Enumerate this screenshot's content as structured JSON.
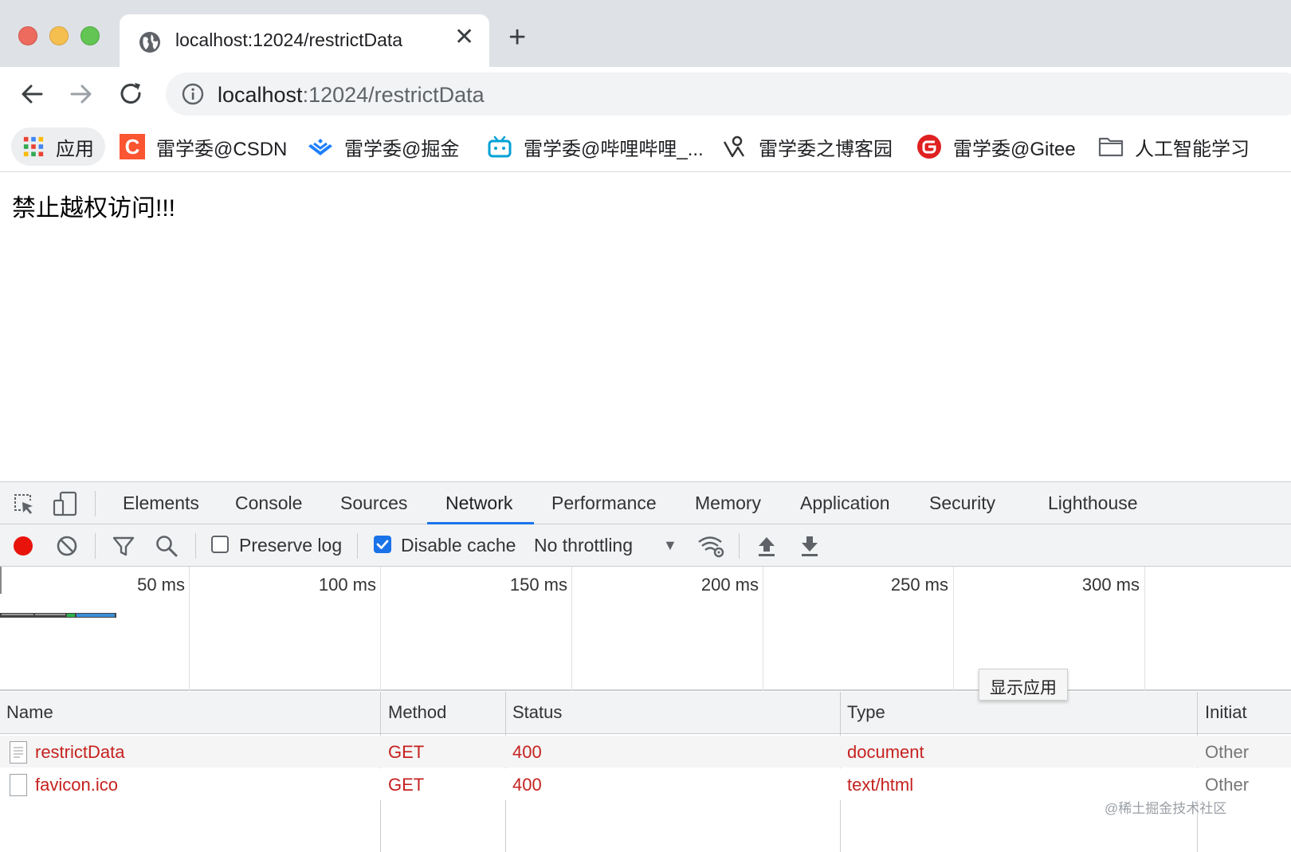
{
  "browser": {
    "tab": {
      "title": "localhost:12024/restrictData"
    },
    "address": {
      "host": "localhost",
      "path": ":12024/restrictData"
    },
    "bookmarks": {
      "apps_label": "应用",
      "items": [
        {
          "label": "雷学委@CSDN"
        },
        {
          "label": "雷学委@掘金"
        },
        {
          "label": "雷学委@哔哩哔哩_..."
        },
        {
          "label": "雷学委之博客园"
        },
        {
          "label": "雷学委@Gitee"
        },
        {
          "label": "人工智能学习"
        }
      ]
    }
  },
  "page": {
    "message": "禁止越权访问!!!"
  },
  "devtools": {
    "tabs": [
      "Elements",
      "Console",
      "Sources",
      "Network",
      "Performance",
      "Memory",
      "Application",
      "Security",
      "Lighthouse"
    ],
    "active_tab": "Network",
    "toolbar": {
      "preserve_log_label": "Preserve log",
      "preserve_log_checked": false,
      "disable_cache_label": "Disable cache",
      "disable_cache_checked": true,
      "throttling": "No throttling"
    },
    "timeline": {
      "ticks": [
        "50 ms",
        "100 ms",
        "150 ms",
        "200 ms",
        "250 ms",
        "300 ms"
      ]
    },
    "tooltip": "显示应用",
    "table": {
      "columns": [
        "Name",
        "Method",
        "Status",
        "Type",
        "Initiat"
      ],
      "rows": [
        {
          "name": "restrictData",
          "method": "GET",
          "status": "400",
          "type": "document",
          "initiator": "Other"
        },
        {
          "name": "favicon.ico",
          "method": "GET",
          "status": "400",
          "type": "text/html",
          "initiator": "Other"
        }
      ]
    }
  },
  "watermark": "@稀土掘金技术社区",
  "colors": {
    "accent": "#1a73e8",
    "error_text": "#c5221f",
    "record": "#e8140c"
  }
}
